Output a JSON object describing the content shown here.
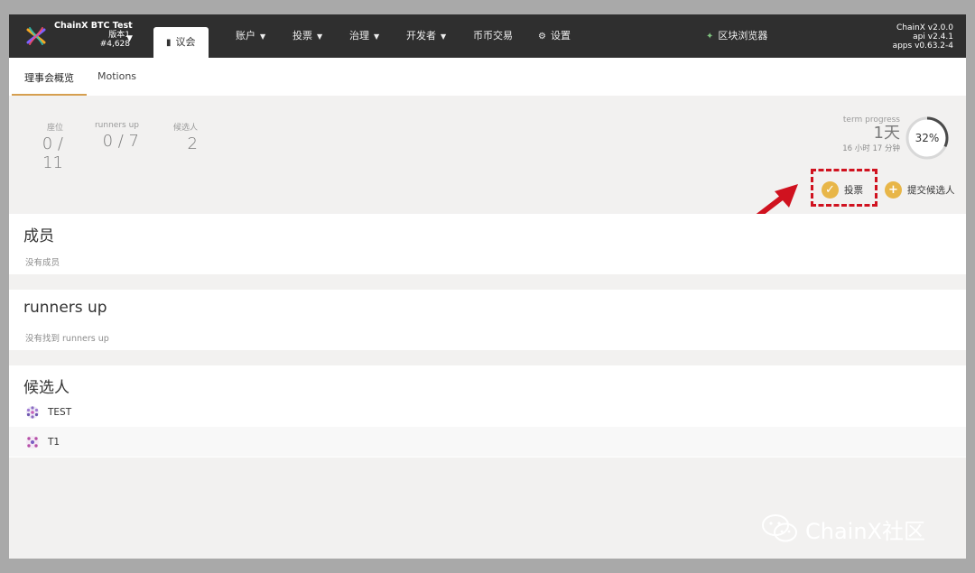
{
  "header": {
    "chain_name": "ChainX BTC Test",
    "version_line": "版本1",
    "block_line": "#4,628",
    "nav": {
      "council": "议会",
      "accounts": "账户",
      "voting": "投票",
      "governance": "治理",
      "developer": "开发者",
      "exchange": "币币交易",
      "settings": "设置",
      "explorer": "区块浏览器"
    },
    "versions": [
      "ChainX v2.0.0",
      "api v2.4.1",
      "apps v0.63.2-4"
    ]
  },
  "tabs": [
    "理事会概览",
    "Motions"
  ],
  "summary": {
    "seats": {
      "label": "座位",
      "value": "0 / 11"
    },
    "runners_up": {
      "label": "runners up",
      "value": "0 / 7"
    },
    "candidates": {
      "label": "候选人",
      "value": "2"
    },
    "term": {
      "label": "term progress",
      "days": "1天",
      "hours": "16 小时 17 分钟",
      "percent": "32%",
      "fraction": 0.32
    }
  },
  "actions": {
    "vote": "投票",
    "submit_candidate": "提交候选人"
  },
  "sections": {
    "members": {
      "title": "成员",
      "empty": "没有成员"
    },
    "runners_up": {
      "title": "runners up",
      "empty": "没有找到 runners up"
    },
    "candidates": {
      "title": "候选人",
      "items": [
        "TEST",
        "T1"
      ]
    }
  },
  "watermark": "ChainX社区",
  "colors": {
    "nav_bg": "#2f2f2f",
    "accent": "#e8b648",
    "tab_underline": "#d69f4f",
    "highlight": "#d0121f"
  }
}
